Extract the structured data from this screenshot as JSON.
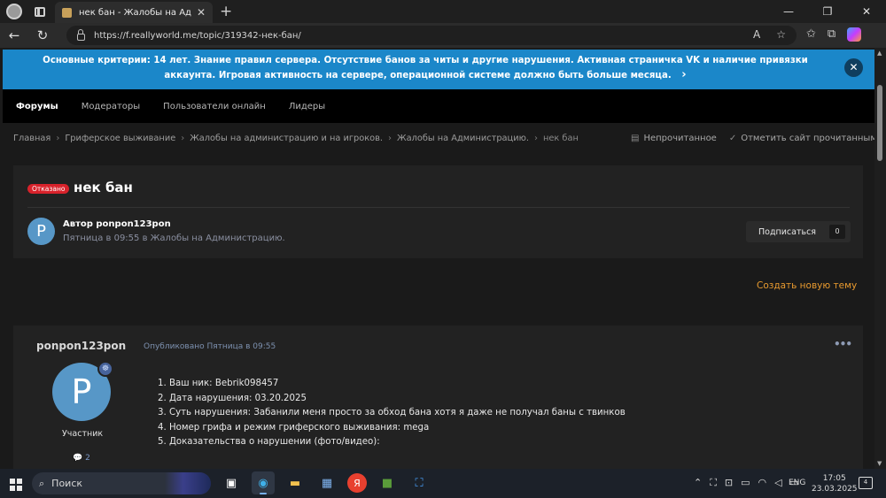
{
  "browser": {
    "tab_title": "нек бан - Жалобы на Администр",
    "tab_close": "✕",
    "new_tab": "+",
    "url": "https://f.reallyworld.me/topic/319342-нек-бан/",
    "window_controls": [
      "—",
      "❐",
      "✕"
    ]
  },
  "notice": {
    "text": "Основные критерии: 14 лет. Знание правил сервера. Отсутствие банов за читы и другие нарушения. Активная страничка VK и наличие привязки аккаунта. Игровая активность на сервере, операционной системе должно быть больше месяца.",
    "arrow": "›",
    "close": "✕"
  },
  "nav": {
    "items": [
      "Форумы",
      "Модераторы",
      "Пользователи онлайн",
      "Лидеры"
    ]
  },
  "breadcrumb": {
    "items": [
      "Главная",
      "Гриферское выживание",
      "Жалобы на администрацию и на игроков.",
      "Жалобы на Администрацию.",
      "нек бан"
    ],
    "sep": "›",
    "unread": "Непрочитанное",
    "mark_read": "Отметить сайт прочитанным"
  },
  "topic": {
    "status": "Отказано",
    "title": "нек бан",
    "author_prefix": "Автор",
    "author": "ponpon123pon",
    "date_line": "Пятница в 09:55 в Жалобы на Администрацию.",
    "avatar_letter": "P",
    "subscribe": "Подписаться",
    "subscribe_count": "0",
    "new_topic": "Создать новую тему"
  },
  "post": {
    "author": "ponpon123pon",
    "published": "Опубликовано Пятница в 09:55",
    "menu": "•••",
    "avatar_letter": "P",
    "role": "Участник",
    "count": "2",
    "lines": [
      "1. Ваш ник: Bebrik098457",
      "2. Дата нарушения: 03.20.2025",
      "3. Суть нарушения: Забанили меня просто за обход бана хотя я даже не получал баны с твинков",
      "4. Номер грифа и режим гриферского выживания: mega",
      "5. Доказательства о нарушении (фото/видео):"
    ]
  },
  "taskbar": {
    "search": "Поиск",
    "lang": "ENG",
    "time": "17:05",
    "date": "23.03.2025",
    "notif_count": "4"
  },
  "colors": {
    "accent": "#1b87c9",
    "status_red": "#d8222b",
    "link_orange": "#e89a2f",
    "avatar": "#5797c7"
  }
}
